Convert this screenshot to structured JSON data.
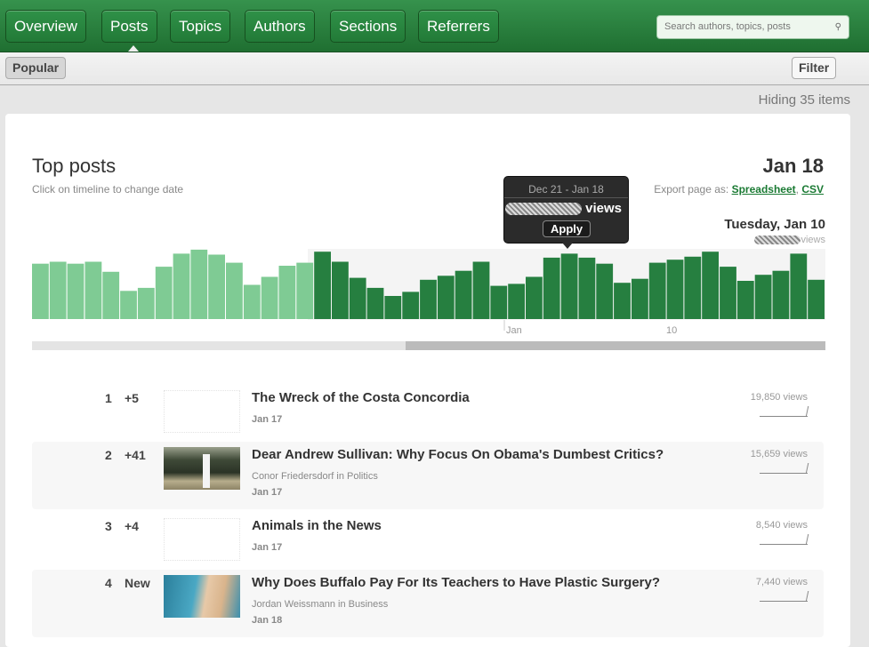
{
  "nav": {
    "tabs": [
      "Overview",
      "Posts",
      "Topics",
      "Authors",
      "Sections",
      "Referrers"
    ],
    "active": "Posts",
    "search_placeholder": "Search authors, topics, posts"
  },
  "subbar": {
    "popular": "Popular",
    "filter": "Filter"
  },
  "hiding": "Hiding 35 items",
  "page": {
    "title": "Top posts",
    "hint": "Click on timeline to change date",
    "date": "Jan 18",
    "export_label": "Export page as:",
    "export_spreadsheet": "Spreadsheet",
    "export_sep": ",",
    "export_csv": "CSV"
  },
  "tooltip": {
    "range": "Dec 21 - Jan 18",
    "views_label": "views",
    "apply": "Apply"
  },
  "hover": {
    "day": "Tuesday, Jan 10",
    "views_label": "views"
  },
  "chart_data": {
    "type": "bar",
    "title": "Daily views (relative)",
    "x_ticks": [
      "Jan",
      "10"
    ],
    "unselected_values": [
      165,
      171,
      165,
      171,
      141,
      84,
      93,
      156,
      195,
      207,
      192,
      168,
      102,
      126,
      159,
      168
    ],
    "selected_values": [
      201,
      171,
      123,
      93,
      69,
      81,
      117,
      129,
      144,
      171,
      99,
      105,
      126,
      183,
      195,
      183,
      165,
      108,
      120,
      168,
      177,
      186,
      201,
      156,
      114,
      132,
      144,
      195,
      117
    ],
    "colors": {
      "unselected": "#7fcb94",
      "selected": "#267f40"
    }
  },
  "posts": [
    {
      "rank": "1",
      "change": "+5",
      "title": "The Wreck of the Costa Concordia",
      "author": "",
      "date": "Jan 17",
      "views": "19,850 views",
      "thumb": "none"
    },
    {
      "rank": "2",
      "change": "+41",
      "title": "Dear Andrew Sullivan: Why Focus On Obama's Dumbest Critics?",
      "author": "Conor Friedersdorf in Politics",
      "date": "Jan 17",
      "views": "15,659 views",
      "thumb": "helicopter"
    },
    {
      "rank": "3",
      "change": "+4",
      "title": "Animals in the News",
      "author": "",
      "date": "Jan 17",
      "views": "8,540 views",
      "thumb": "none"
    },
    {
      "rank": "4",
      "change": "New",
      "title": "Why Does Buffalo Pay For Its Teachers to Have Plastic Surgery?",
      "author": "Jordan Weissmann in Business",
      "date": "Jan 18",
      "views": "7,440 views",
      "thumb": "patient"
    }
  ]
}
